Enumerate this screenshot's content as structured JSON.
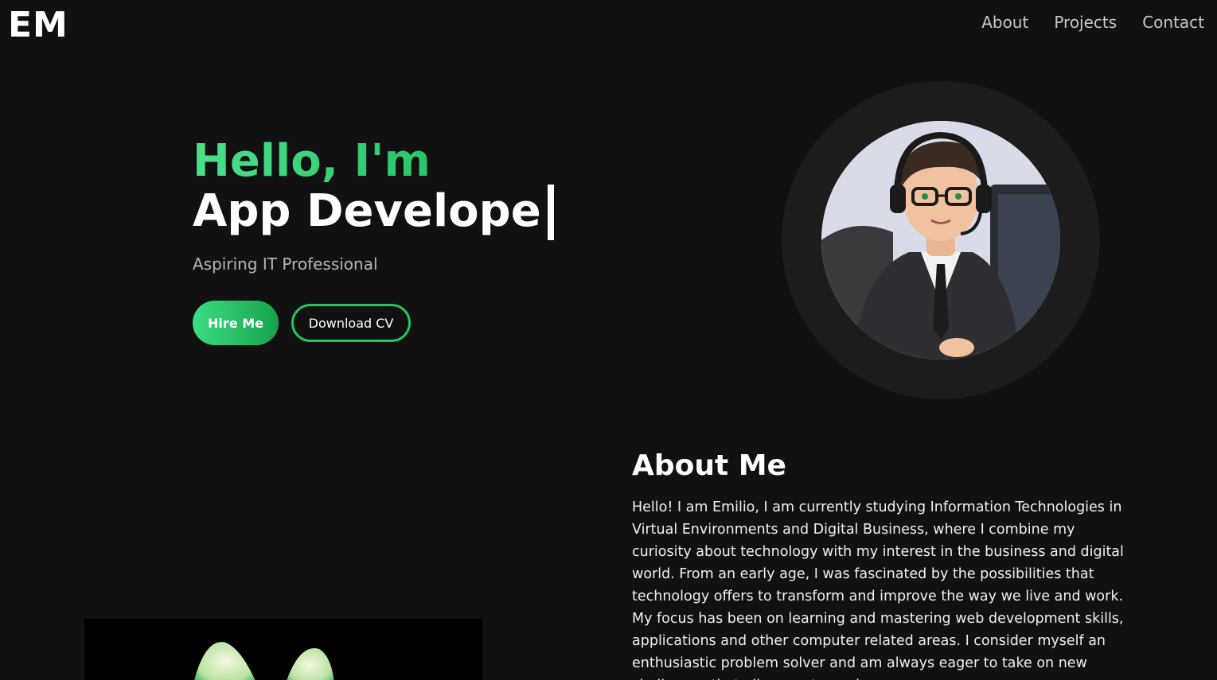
{
  "header": {
    "logo": "EM",
    "nav": [
      {
        "label": "About"
      },
      {
        "label": "Projects"
      },
      {
        "label": "Contact"
      }
    ]
  },
  "hero": {
    "greeting": "Hello, I'm",
    "role": "App Develope",
    "subtitle": "Aspiring IT Professional",
    "hire_label": "Hire Me",
    "cv_label": "Download CV"
  },
  "about": {
    "title": "About Me",
    "text": "Hello! I am Emilio, I am currently studying Information Technologies in Virtual Environments and Digital Business, where I combine my curiosity about technology with my interest in the business and digital world. From an early age, I was fascinated by the possibilities that technology offers to transform and improve the way we live and work. My focus has been on learning and mastering web development skills, applications and other computer related areas. I consider myself an enthusiastic problem solver and am always eager to take on new challenges that allow me to apply"
  },
  "colors": {
    "background": "#111111",
    "accent": "#22c55e",
    "accent_light": "#4be08a"
  }
}
